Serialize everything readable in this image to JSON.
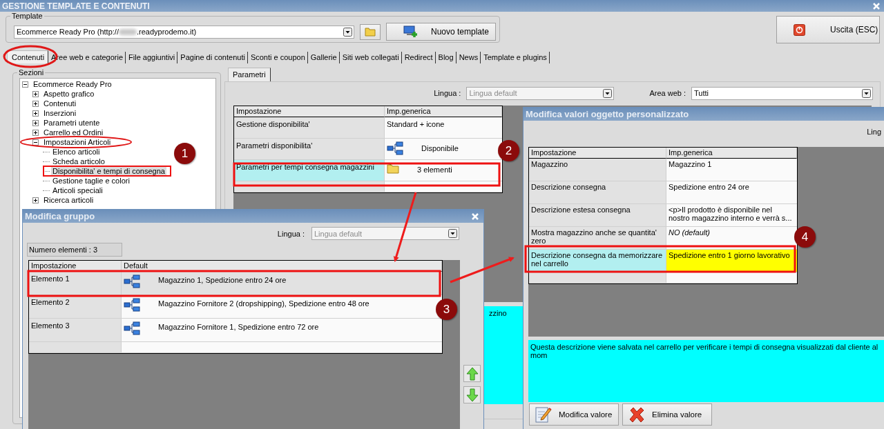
{
  "window": {
    "title": "GESTIONE TEMPLATE E CONTENUTI"
  },
  "template": {
    "legend": "Template",
    "value_start": "Ecommerce Ready Pro (http://",
    "value_end": ".readyprodemo.it)",
    "new_button": "Nuovo template"
  },
  "exit_button": "Uscita (ESC)",
  "tabs": [
    {
      "label": "Contenuti",
      "selected": true
    },
    {
      "label": "Aree web e categorie",
      "selected": false
    },
    {
      "label": "File aggiuntivi",
      "selected": false
    },
    {
      "label": "Pagine di contenuti",
      "selected": false
    },
    {
      "label": "Sconti e coupon",
      "selected": false
    },
    {
      "label": "Gallerie",
      "selected": false
    },
    {
      "label": "Siti web collegati",
      "selected": false
    },
    {
      "label": "Redirect",
      "selected": false
    },
    {
      "label": "Blog",
      "selected": false
    },
    {
      "label": "News",
      "selected": false
    },
    {
      "label": "Template e plugins",
      "selected": false
    }
  ],
  "sections": {
    "legend": "Sezioni",
    "tree": [
      {
        "label": "Ecommerce Ready Pro",
        "expanded": true,
        "selected": false,
        "children": [
          {
            "label": "Aspetto grafico",
            "expanded": false,
            "selected": false
          },
          {
            "label": "Contenuti",
            "expanded": false,
            "selected": false
          },
          {
            "label": "Inserzioni",
            "expanded": false,
            "selected": false
          },
          {
            "label": "Parametri utente",
            "expanded": false,
            "selected": false
          },
          {
            "label": "Carrello ed Ordini",
            "expanded": false,
            "selected": false
          },
          {
            "label": "Impostazioni Articoli",
            "expanded": true,
            "selected": false,
            "children": [
              {
                "label": "Elenco articoli",
                "selected": false
              },
              {
                "label": "Scheda articolo",
                "selected": false
              },
              {
                "label": "Disponibilita' e tempi di consegna",
                "selected": true
              },
              {
                "label": "Gestione taglie e colori",
                "selected": false
              },
              {
                "label": "Articoli speciali",
                "selected": false
              }
            ]
          },
          {
            "label": "Ricerca articoli",
            "expanded": false,
            "selected": false
          }
        ]
      }
    ]
  },
  "params": {
    "tab": {
      "label": "Parametri",
      "selected": true
    },
    "language_label": "Lingua :",
    "language_value": "Lingua default",
    "area_label": "Area web :",
    "area_value": "Tutti",
    "columns": [
      "Impostazione",
      "Imp.generica"
    ],
    "rows": [
      {
        "setting": "Gestione disponibilita'",
        "value": "Standard + icone",
        "kind": "text",
        "selected": false
      },
      {
        "setting": "Parametri disponibilita'",
        "value": "Disponibile",
        "kind": "tree",
        "selected": false
      },
      {
        "setting": "Parametri per tempi consegna magazzini",
        "value": "3 elementi",
        "kind": "folder",
        "selected": true
      }
    ],
    "description": "zzino"
  },
  "group_dialog": {
    "title": "Modifica gruppo",
    "language_label": "Lingua :",
    "language_value": "Lingua default",
    "count": "Numero elementi : 3",
    "columns": [
      "Impostazione",
      "Default"
    ],
    "rows": [
      {
        "name": "Elemento 1",
        "value": "Magazzino 1, Spedizione entro 24 ore",
        "selected": true
      },
      {
        "name": "Elemento 2",
        "value": "Magazzino Fornitore 2 (dropshipping), Spedizione entro 48 ore",
        "selected": false
      },
      {
        "name": "Elemento 3",
        "value": "Magazzino Fornitore 1, Spedizione entro 72 ore",
        "selected": false
      }
    ]
  },
  "object_dialog": {
    "title": "Modifica valori oggetto personalizzato",
    "language_label": "Ling",
    "columns": [
      "Impostazione",
      "Imp.generica"
    ],
    "rows": [
      {
        "setting": "Magazzino",
        "value": "Magazzino 1",
        "selected": false,
        "is_default": false,
        "editing": false
      },
      {
        "setting": "Descrizione consegna",
        "value": "Spedizione entro 24 ore",
        "selected": false,
        "is_default": false,
        "editing": false
      },
      {
        "setting": "Descrizione estesa consegna",
        "value": "<p>Il prodotto è disponibile nel nostro magazzino interno e verrà s...",
        "selected": false,
        "is_default": false,
        "editing": false
      },
      {
        "setting": "Mostra magazzino anche se quantita' zero",
        "value": "NO (default)",
        "selected": false,
        "is_default": true,
        "editing": false
      },
      {
        "setting": "Descrizione consegna da memorizzare nel carrello",
        "value": "Spedizione entro 1 giorno lavorativo",
        "selected": true,
        "is_default": false,
        "editing": true
      }
    ],
    "description": "Questa descrizione viene salvata nel carrello per verificare i tempi di consegna visualizzati dal cliente al mom",
    "buttons": [
      {
        "label": "Modifica valore",
        "kind": "edit"
      },
      {
        "label": "Elimina valore",
        "kind": "delete"
      }
    ]
  },
  "annotations": [
    {
      "label": "1"
    },
    {
      "label": "2"
    },
    {
      "label": "3"
    },
    {
      "label": "4"
    }
  ]
}
